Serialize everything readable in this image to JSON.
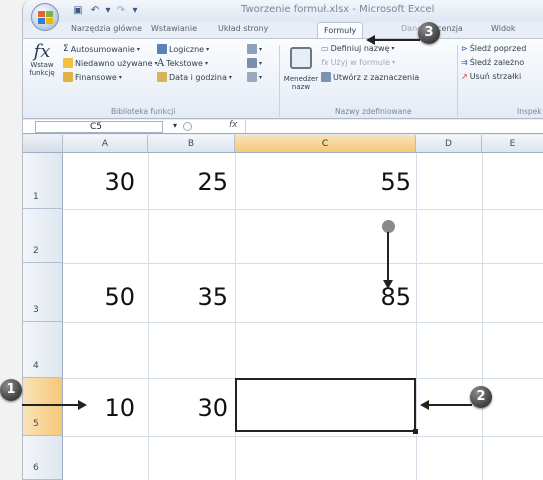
{
  "window": {
    "title": "Tworzenie formul.xlsx - Microsoft Excel",
    "title_visible": "Tworzenie formuł.xlsx - Microsoft Excel"
  },
  "tabs": [
    {
      "label": "Narzędzia główne"
    },
    {
      "label": "Wstawianie"
    },
    {
      "label": "Układ strony"
    },
    {
      "label": "Formuły",
      "active": true
    },
    {
      "label": "Dane"
    },
    {
      "label": "Recenzja"
    },
    {
      "label": "Widok"
    }
  ],
  "ribbon": {
    "insert_function": {
      "line1": "Wstaw",
      "line2": "funkcję"
    },
    "library": {
      "autosum": "Autosumowanie",
      "recent": "Niedawno używane",
      "financial": "Finansowe",
      "logical": "Logiczne",
      "text": "Tekstowe",
      "datetime": "Data i godzina",
      "group_label": "Biblioteka funkcji"
    },
    "names": {
      "manager_line1": "Menedżer",
      "manager_line2": "nazw",
      "define": "Definiuj nazwę",
      "use": "Użyj w formule",
      "create": "Utwórz z zaznaczenia",
      "group_label": "Nazwy zdefiniowane"
    },
    "audit": {
      "trace_prec": "Śledź poprzed",
      "trace_dep": "Śledź zależno",
      "remove_arrows": "Usuń strzałki",
      "group_label": "Inspek"
    }
  },
  "formula_bar": {
    "name_box": "C5",
    "fx_label": "fx",
    "formula": ""
  },
  "columns": [
    "A",
    "B",
    "C",
    "D",
    "E"
  ],
  "rows": [
    "1",
    "2",
    "3",
    "4",
    "5",
    "6"
  ],
  "cells": {
    "A1": "30",
    "B1": "25",
    "C1": "55",
    "A3": "50",
    "B3": "35",
    "C3": "85",
    "A5": "10",
    "B5": "30",
    "C5": ""
  },
  "callouts": {
    "one": "1",
    "two": "2",
    "three": "3"
  },
  "colors": {
    "selected_header": "#f5c878",
    "ribbon_bg": "#e4ebf5",
    "active_border": "#222222"
  }
}
